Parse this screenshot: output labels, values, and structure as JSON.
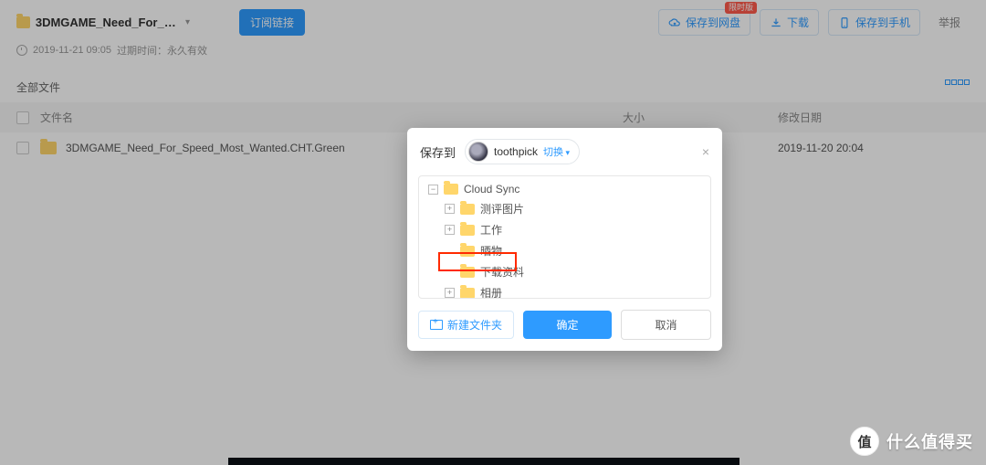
{
  "header": {
    "title": "3DMGAME_Need_For_Sp...",
    "subscribe_label": "订阅链接",
    "save_cloud_label": "保存到网盘",
    "save_cloud_badge": "限时版",
    "download_label": "下载",
    "save_phone_label": "保存到手机",
    "report_label": "举报"
  },
  "meta": {
    "timestamp": "2019-11-21 09:05",
    "expire_label": "过期时间：永久有效"
  },
  "crumb": {
    "all_files": "全部文件"
  },
  "columns": {
    "name": "文件名",
    "size": "大小",
    "date": "修改日期"
  },
  "rows": [
    {
      "name": "3DMGAME_Need_For_Speed_Most_Wanted.CHT.Green",
      "size": "-",
      "date": "2019-11-20 20:04"
    }
  ],
  "modal": {
    "title": "保存到",
    "username": "toothpick",
    "switch_label": "切换",
    "tree": [
      {
        "label": "Cloud Sync",
        "level": 0,
        "expander": "−"
      },
      {
        "label": "测评图片",
        "level": 1,
        "expander": "+"
      },
      {
        "label": "工作",
        "level": 1,
        "expander": "+"
      },
      {
        "label": "晒物",
        "level": 1,
        "expander": ""
      },
      {
        "label": "下载资料",
        "level": 1,
        "expander": ""
      },
      {
        "label": "相册",
        "level": 1,
        "expander": "+"
      }
    ],
    "new_folder_label": "新建文件夹",
    "ok_label": "确定",
    "cancel_label": "取消"
  },
  "watermark": {
    "char": "值",
    "text": "什么值得买"
  }
}
